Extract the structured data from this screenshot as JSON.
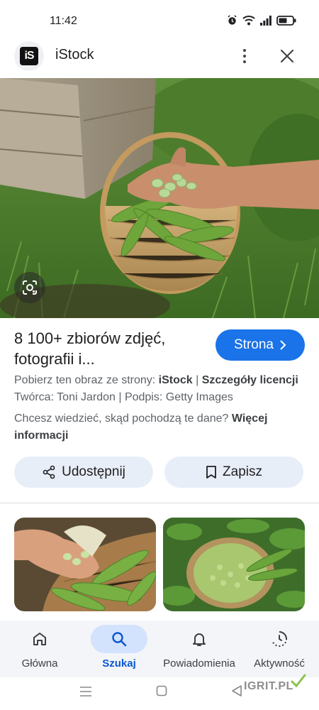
{
  "status_bar": {
    "time": "11:42",
    "icons": [
      "alarm-icon",
      "wifi-icon",
      "signal-icon",
      "battery-icon"
    ]
  },
  "header": {
    "site_logo_text": "iS",
    "site_name": "iStock",
    "more_icon": "more-vert-icon",
    "close_icon": "close-icon"
  },
  "hero": {
    "image": "basket-of-broad-beans-in-hand",
    "lens_icon": "google-lens-icon"
  },
  "result": {
    "title": "8 100+ zbiorów zdjęć, fotografii i...",
    "visit_label": "Strona",
    "visit_icon": "chevron-right-icon",
    "source_prefix": "Pobierz ten obraz ze strony: ",
    "source_name": "iStock",
    "source_sep": " | ",
    "license_link": "Szczegóły licencji",
    "author_line": "Twórca: Toni Jardon | Podpis: Getty Images",
    "info_question": "Chcesz wiedzieć, skąd pochodzą te dane? ",
    "info_link": "Więcej informacji"
  },
  "actions": {
    "share_label": "Udostępnij",
    "share_icon": "share-icon",
    "save_label": "Zapisz",
    "save_icon": "bookmark-icon"
  },
  "related": [
    {
      "image": "hands-holding-broad-beans-over-basket"
    },
    {
      "image": "sieve-of-shelled-beans-among-leaves"
    }
  ],
  "bottom_nav": [
    {
      "label": "Główna",
      "icon": "home-icon",
      "active": false
    },
    {
      "label": "Szukaj",
      "icon": "search-icon",
      "active": true
    },
    {
      "label": "Powiadomienia",
      "icon": "bell-icon",
      "active": false
    },
    {
      "label": "Aktywność",
      "icon": "activity-icon",
      "active": false
    }
  ],
  "system_nav": {
    "icons": [
      "menu-icon",
      "home-square-icon",
      "back-icon"
    ]
  },
  "watermark": {
    "text": "IGRIT.PL"
  },
  "colors": {
    "accent": "#1a73e8",
    "pill_bg": "#e8eef8",
    "nav_active_bg": "#d3e3fd",
    "nav_active_text": "#0b57d0"
  }
}
